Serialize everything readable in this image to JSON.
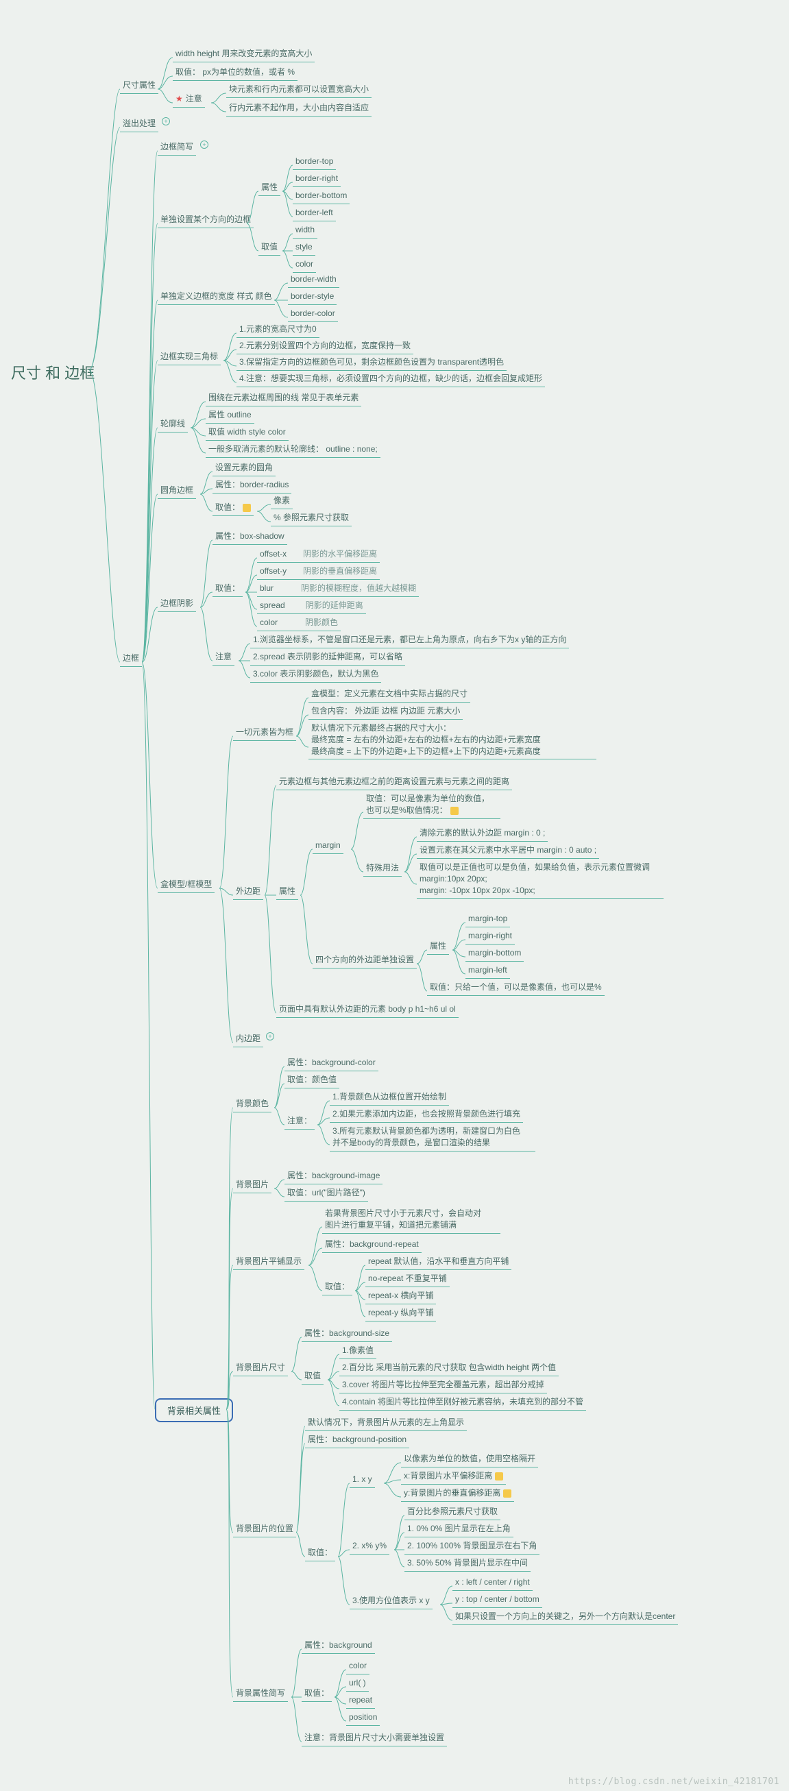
{
  "root": "尺寸 和 边框",
  "watermark": "https://blog.csdn.net/weixin_42181701",
  "n": {
    "dimAttr": "尺寸属性",
    "wh": "width height  用来改变元素的宽高大小",
    "whVal": "取值： px为单位的数值，或者 %",
    "whNote": "注意",
    "whNote1": "块元素和行内元素都可以设置宽高大小",
    "whNote2": "行内元素不起作用，大小由内容自适应",
    "overflow": "溢出处理",
    "border": "边框",
    "bShort": "边框简写",
    "bSide": "单独设置某个方向的边框",
    "bAttr": "属性",
    "bTop": "border-top",
    "bRight": "border-right",
    "bBottom": "border-bottom",
    "bLeft": "border-left",
    "bVal": "取值",
    "bWidth": "width",
    "bStyle": "style",
    "bColor": "color",
    "bSep": "单独定义边框的宽度 样式 颜色",
    "bw": "border-width",
    "bs": "border-style",
    "bc": "border-color",
    "triangle": "边框实现三角标",
    "t1": "1.元素的宽高尺寸为0",
    "t2": "2.元素分别设置四个方向的边框，宽度保持一致",
    "t3": "3.保留指定方向的边框颜色可见，剩余边框颜色设置为 transparent透明色",
    "t4": "4.注意：想要实现三角标，必须设置四个方向的边框，缺少的话，边框会回复成矩形",
    "outline": "轮廓线",
    "o1": "围绕在元素边框周围的线          常见于表单元素",
    "o2": "属性  outline",
    "o3": "取值  width style  color",
    "o4": "一般多取消元素的默认轮廓线： outline : none;",
    "radius": "圆角边框",
    "r1": "设置元素的圆角",
    "r2": "属性：border-radius",
    "r3": "取值：",
    "r3a": "像素",
    "r3b": "%  参照元素尺寸获取",
    "shadow": "边框阴影",
    "s1": "属性：box-shadow",
    "s2": "取值：",
    "s2a": "offset-x",
    "s2aL": "阴影的水平偏移距离",
    "s2b": "offset-y",
    "s2bL": "阴影的垂直偏移距离",
    "s2c": "blur",
    "s2cL": "阴影的模糊程度，值越大越模糊",
    "s2d": "spread",
    "s2dL": "阴影的延伸距离",
    "s2e": "color",
    "s2eL": "阴影颜色",
    "sNote": "注意",
    "sn1": "1.浏览器坐标系，不管是窗口还是元素，都已左上角为原点，向右乡下为x y轴的正方向",
    "sn2": "2.spread 表示阴影的延伸距离，可以省略",
    "sn3": "3.color   表示阴影颜色，默认为黑色",
    "box": "盒模型/框模型",
    "allBox": "一切元素皆为框",
    "ab1": "盒模型：定义元素在文档中实际占据的尺寸",
    "ab2": "包含内容： 外边距 边框 内边距 元素大小",
    "ab3": "默认情况下元素最终占据的尺寸大小：\n最终宽度 = 左右的外边距+左右的边框+左右的内边距+元素宽度\n最终高度 = 上下的外边距+上下的边框+上下的内边距+元素高度",
    "margin": "外边距",
    "m0": "元素边框与其他元素边框之前的距离设置元素与元素之间的距离",
    "mAttr": "属性",
    "marginLbl": "margin",
    "mVal": "取值：可以是像素为单位的数值，\n也可以是%取值情况：",
    "mSpec": "特殊用法",
    "ms1": "清除元素的默认外边距   margin : 0 ;",
    "ms2": "设置元素在其父元素中水平居中   margin : 0 auto ;",
    "ms3": "取值可以是正值也可以是负值，如果给负值，表示元素位置微调\nmargin:10px 20px;\nmargin: -10px 10px 20px -10px;",
    "m4": "四个方向的外边距单独设置",
    "m4a": "属性",
    "mt": "margin-top",
    "mr": "margin-right",
    "mb": "margin-bottom",
    "ml": "margin-left",
    "m4v": "取值：只给一个值，可以是像素值，也可以是%",
    "mDef": "页面中具有默认外边距的元素          body p h1~h6 ul ol",
    "padding": "内边距",
    "bg": "背景相关属性",
    "bgColor": "背景颜色",
    "bgc1": "属性：background-color",
    "bgc2": "取值：颜色值",
    "bgcNote": "注意：",
    "bgcn1": "1.背景颜色从边框位置开始绘制",
    "bgcn2": "2.如果元素添加内边距，也会按照背景颜色进行填充",
    "bgcn3": "3.所有元素默认背景颜色都为透明，新建窗口为白色\n并不是body的背景颜色，是窗口渲染的结果",
    "bgImg": "背景图片",
    "bgi1": "属性：background-image",
    "bgi2": "取值：url(\"图片路径\")",
    "bgRepeat": "背景图片平铺显示",
    "bgr0": "若果背景图片尺寸小于元素尺寸，会自动对\n图片进行重复平铺，知道把元素铺满",
    "bgr1": "属性：background-repeat",
    "bgr2": "取值：",
    "bgrA": "repeat   默认值，沿水平和垂直方向平铺",
    "bgrB": "no-repeat  不重复平铺",
    "bgrC": "repeat-x         横向平铺",
    "bgrD": "repeat-y         纵向平铺",
    "bgSize": "背景图片尺寸",
    "bgs1": "属性：background-size",
    "bgs2": "取值",
    "bgsA": "1.像素值",
    "bgsB": "2.百分比  采用当前元素的尺寸获取 包含width height 两个值",
    "bgsC": "3.cover 将图片等比拉伸至完全覆盖元素，超出部分戒掉",
    "bgsD": "4.contain 将图片等比拉伸至刚好被元素容纳，未填充到的部分不管",
    "bgPos": "背景图片的位置",
    "bgp0": "默认情况下，背景图片从元素的左上角显示",
    "bgp1": "属性：background-position",
    "bgp2": "取值：",
    "bgpA": "1.  x y",
    "bgpA0": "以像素为单位的数值，使用空格隔开",
    "bgpA1": "x:背景图片水平偏移距离",
    "bgpA2": "y:背景图片的垂直偏移距离",
    "bgpB": "2.  x% y%",
    "bgpB0": "百分比参照元素尺寸获取",
    "bgpB1": "1. 0% 0%   图片显示在左上角",
    "bgpB2": "2. 100%  100%   背景图显示在右下角",
    "bgpB3": "3. 50% 50%  背景图片显示在中间",
    "bgpC": "3.使用方位值表示 x y",
    "bgpC1": "x : left / center / right",
    "bgpC2": "y : top / center / bottom",
    "bgpC3": "如果只设置一个方向上的关键之，另外一个方向默认是center",
    "bgShort": "背景属性简写",
    "bgSh1": "属性：background",
    "bgSh2": "取值：",
    "bgShA": "color",
    "bgShB": "url( )",
    "bgShC": "repeat",
    "bgShD": "position",
    "bgSh3": "注意：背景图片尺寸大小需要单独设置"
  }
}
